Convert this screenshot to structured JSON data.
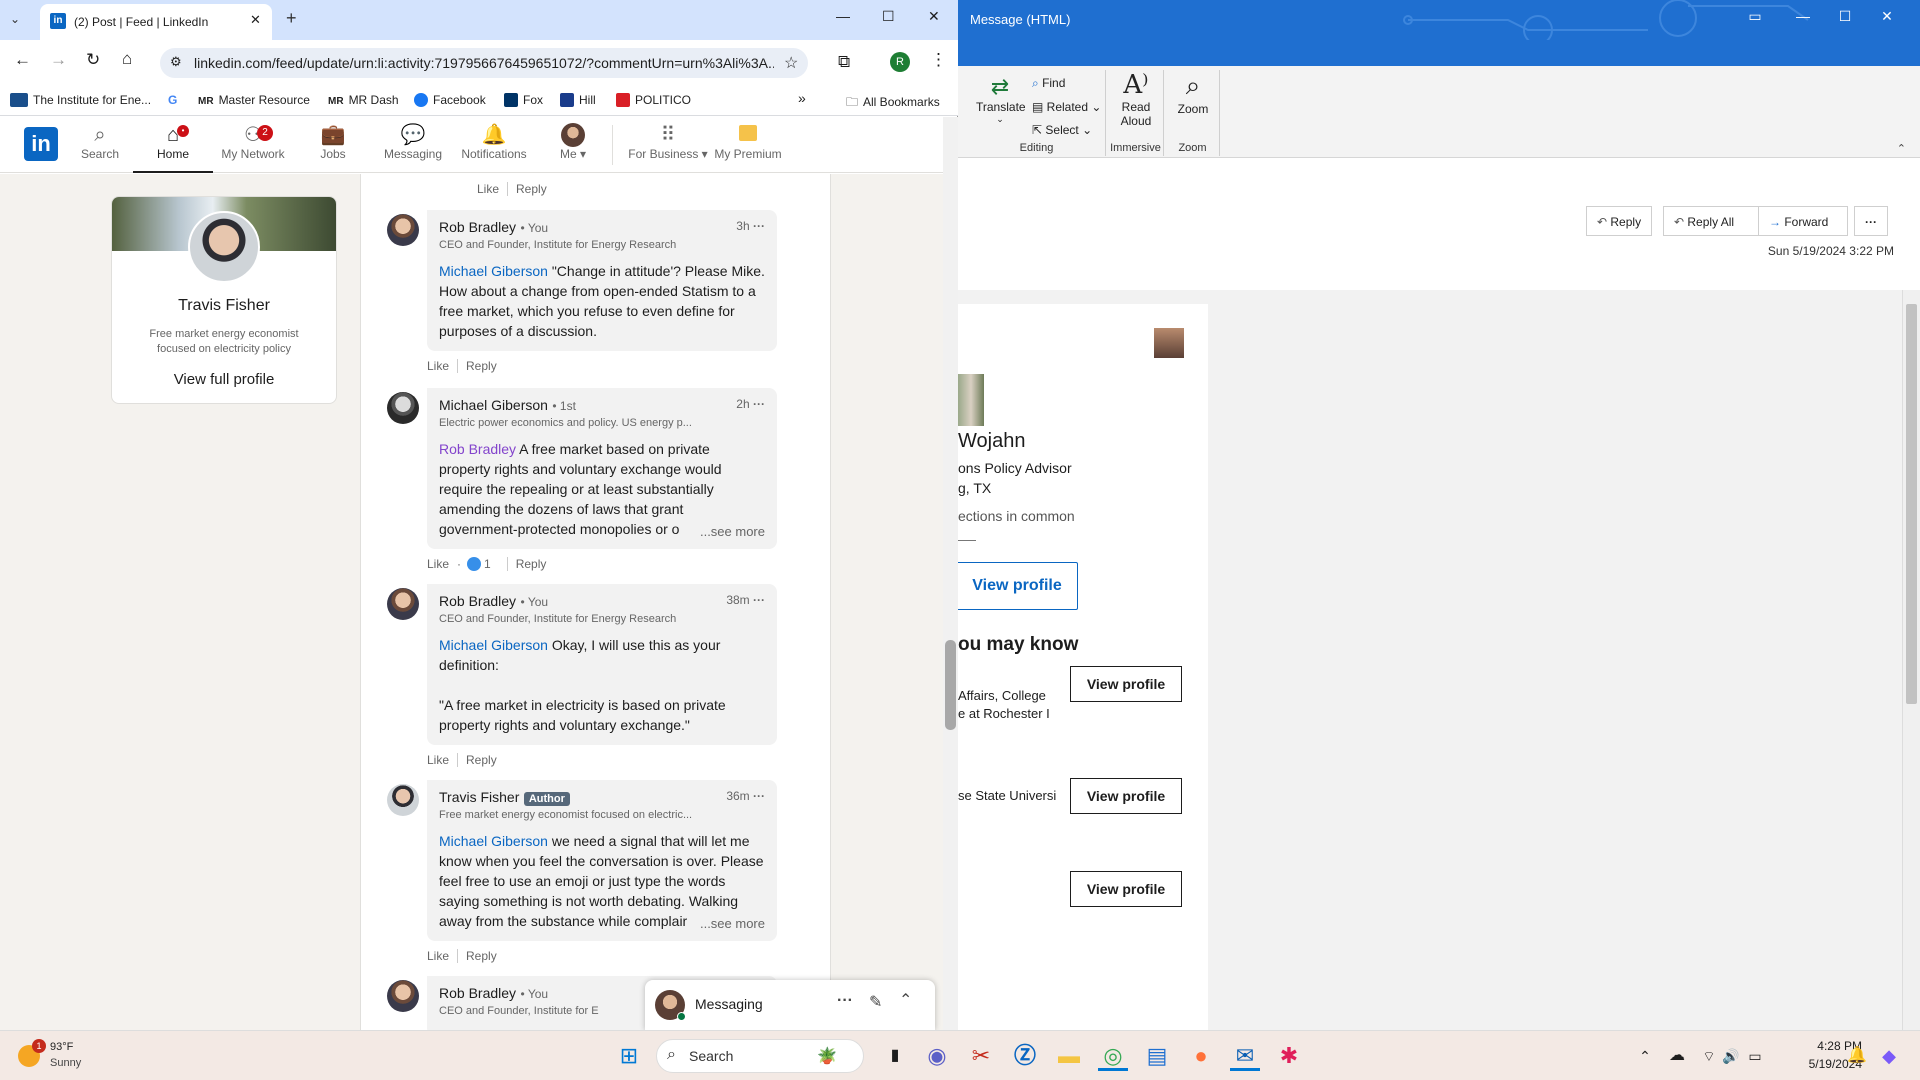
{
  "chrome": {
    "tab_title": "(2) Post | Feed | LinkedIn",
    "url": "linkedin.com/feed/update/urn:li:activity:7197956676459651072/?commentUrn=urn%3Ali%3A...",
    "profile_initial": "R",
    "bookmarks": [
      {
        "label": "The Institute for Ene...",
        "icon": "ier-icon",
        "color": "#1a4f8b"
      },
      {
        "label": "",
        "icon": "google-icon",
        "color": "#4285f4"
      },
      {
        "label": "Master Resource",
        "icon": "mr-icon",
        "color": "#333333"
      },
      {
        "label": "MR Dash",
        "icon": "mr-icon",
        "color": "#333333"
      },
      {
        "label": "Facebook",
        "icon": "facebook-icon",
        "color": "#1877f2"
      },
      {
        "label": "Fox",
        "icon": "fox-icon",
        "color": "#003366"
      },
      {
        "label": "Hill",
        "icon": "hill-icon",
        "color": "#1a3c8b"
      },
      {
        "label": "POLITICO",
        "icon": "politico-icon",
        "color": "#d91f26"
      }
    ],
    "all_bookmarks": "All Bookmarks"
  },
  "linkedin": {
    "nav": [
      {
        "label": "Search",
        "icon": "search-icon",
        "badge": ""
      },
      {
        "label": "Home",
        "icon": "home-icon",
        "badge": "•"
      },
      {
        "label": "My Network",
        "icon": "network-icon",
        "badge": "2"
      },
      {
        "label": "Jobs",
        "icon": "briefcase-icon",
        "badge": ""
      },
      {
        "label": "Messaging",
        "icon": "messaging-icon",
        "badge": ""
      },
      {
        "label": "Notifications",
        "icon": "bell-icon",
        "badge": ""
      },
      {
        "label": "Me",
        "icon": "avatar-icon",
        "badge": ""
      },
      {
        "label": "For Business",
        "icon": "grid-icon",
        "badge": ""
      },
      {
        "label": "My Premium",
        "icon": "premium-icon",
        "badge": ""
      }
    ],
    "profile": {
      "name": "Travis Fisher",
      "headline": "Free market energy economist focused on electricity policy",
      "view_full_profile": "View full profile"
    },
    "prev_actions": {
      "like": "Like",
      "reply": "Reply"
    },
    "comments": [
      {
        "name": "Rob Bradley",
        "degree": "• You",
        "time": "3h",
        "headline": "CEO and Founder, Institute for Energy Research",
        "mention": "Michael Giberson",
        "text": " \"Change in attitude'? Please Mike. How about a change from open-ended Statism to a free market, which you refuse to even define for purposes of a discussion.",
        "like": "Like",
        "reply": "Reply",
        "reactions": "",
        "see_more": ""
      },
      {
        "name": "Michael Giberson",
        "degree": "• 1st",
        "time": "2h",
        "headline": "Electric power economics and policy. US energy p...",
        "mention": "Rob Bradley",
        "text": " A free market based on private property rights and voluntary exchange would require the repealing or at least substantially amending the dozens of laws that grant government-protected monopolies or o",
        "like": "Like",
        "reply": "Reply",
        "reactions": "1",
        "see_more": "...see more"
      },
      {
        "name": "Rob Bradley",
        "degree": "• You",
        "time": "38m",
        "headline": "CEO and Founder, Institute for Energy Research",
        "mention": "Michael Giberson",
        "text": " Okay, I will use this as your definition:",
        "text2": "\"A free market in electricity is based on private property rights and voluntary exchange.\"",
        "like": "Like",
        "reply": "Reply",
        "reactions": "",
        "see_more": ""
      },
      {
        "name": "Travis Fisher",
        "degree": "Author",
        "time": "36m",
        "headline": "Free market energy economist focused on electric...",
        "mention": "Michael Giberson",
        "text": " we need a signal that will let me know when you feel the conversation is over. Please feel free to use an emoji or just type the words saying something is not worth debating. Walking away from the substance while complair",
        "like": "Like",
        "reply": "Reply",
        "reactions": "",
        "see_more": "...see more"
      },
      {
        "name": "Rob Bradley",
        "degree": "• You",
        "time": "",
        "headline": "CEO and Founder, Institute for E",
        "mention": "",
        "text": "",
        "like": "",
        "reply": "",
        "reactions": "",
        "see_more": ""
      }
    ],
    "messaging_label": "Messaging"
  },
  "outlook": {
    "title": "Message (HTML)",
    "ribbon": {
      "translate": "Translate",
      "find": "Find",
      "related": "Related",
      "select": "Select",
      "editing": "Editing",
      "read_aloud": "Read Aloud",
      "immersive": "Immersive",
      "zoom": "Zoom",
      "zoom_group": "Zoom"
    },
    "actions": {
      "reply": "Reply",
      "reply_all": "Reply All",
      "forward": "Forward",
      "more": "···"
    },
    "date": "Sun 5/19/2024 3:22 PM",
    "card": {
      "name_partial": "Wojahn",
      "title_partial": "ons Policy Advisor",
      "location_partial": "g, TX",
      "connections_partial": "ections in common",
      "view_profile": "View profile",
      "may_know": "ou may know",
      "person1": "Affairs, College",
      "person1b": "e at Rochester I",
      "person2": "se State Universi",
      "view_profile_small": "View profile"
    }
  },
  "taskbar": {
    "weather_temp": "93°F",
    "weather_desc": "Sunny",
    "weather_badge": "1",
    "search": "Search",
    "time": "4:28 PM",
    "date": "5/19/2024"
  }
}
